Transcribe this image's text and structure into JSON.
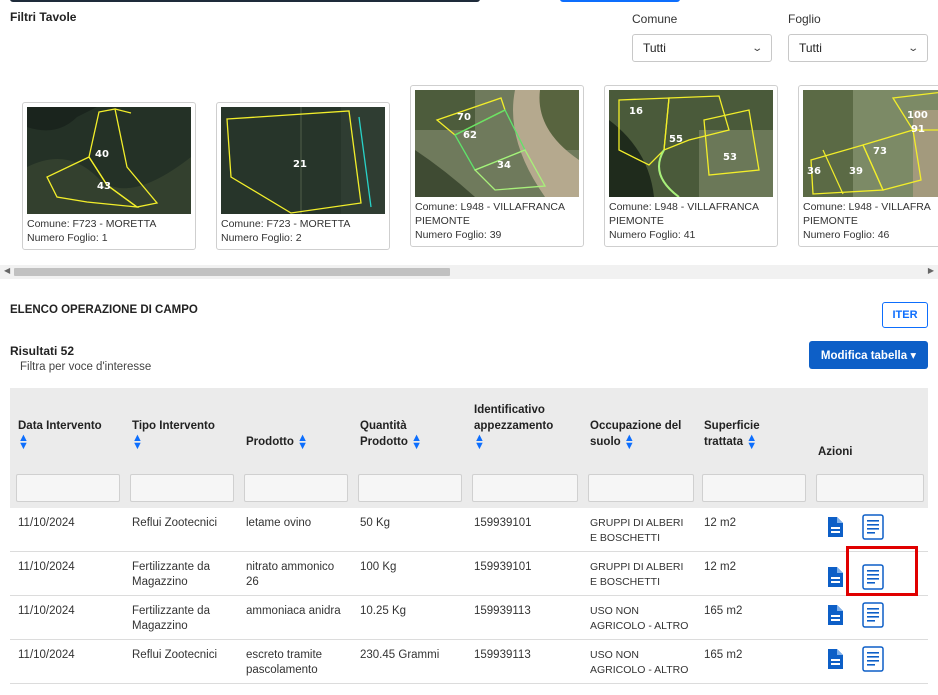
{
  "filters": {
    "title": "Filtri Tavole",
    "comune": {
      "label": "Comune",
      "value": "Tutti"
    },
    "foglio": {
      "label": "Foglio",
      "value": "Tutti"
    }
  },
  "maps": [
    {
      "caption1": "Comune: F723 - MORETTA",
      "caption2": "Numero Foglio: 1",
      "labels": [
        "40",
        "43"
      ]
    },
    {
      "caption1": "Comune: F723 - MORETTA",
      "caption2": "Numero Foglio: 2",
      "labels": [
        "21"
      ]
    },
    {
      "caption1": "Comune: L948 - VILLAFRANCA PIEMONTE",
      "caption2": "Numero Foglio: 39",
      "labels": [
        "70",
        "62",
        "34"
      ]
    },
    {
      "caption1": "Comune: L948 - VILLAFRANCA PIEMONTE",
      "caption2": "Numero Foglio: 41",
      "labels": [
        "16",
        "55",
        "53"
      ]
    },
    {
      "caption1": "Comune: L948 - VILLAFRA",
      "caption2": "PIEMONTE",
      "caption3": "Numero Foglio: 46",
      "labels": [
        "100",
        "91",
        "73",
        "36",
        "39"
      ]
    }
  ],
  "section": {
    "title": "ELENCO OPERAZIONE DI CAMPO",
    "iter_label": "ITER",
    "results": "Risultati 52",
    "filter_hint": "Filtra per voce d'interesse",
    "modifica_label": "Modifica tabella ▾"
  },
  "table": {
    "headers": {
      "data": "Data Intervento",
      "tipo": "Tipo Intervento",
      "prodotto": "Prodotto",
      "quantita_l1": "Quantità",
      "quantita_l2": "Prodotto",
      "ident_l1": "Identificativo",
      "ident_l2": "appezzamento",
      "occ_l1": "Occupazione del",
      "occ_l2": "suolo",
      "sup_l1": "Superficie",
      "sup_l2": "trattata",
      "azioni": "Azioni"
    },
    "rows": [
      {
        "data": "11/10/2024",
        "tipo_l1": "Reflui Zootecnici",
        "tipo_l2": "",
        "prodotto_l1": "letame ovino",
        "prodotto_l2": "",
        "quantita": "50 Kg",
        "ident": "159939101",
        "occ_l1": "GRUPPI DI ALBERI",
        "occ_l2": "E BOSCHETTI",
        "sup": "12 m2"
      },
      {
        "data": "11/10/2024",
        "tipo_l1": "Fertilizzante da",
        "tipo_l2": "Magazzino",
        "prodotto_l1": "nitrato ammonico",
        "prodotto_l2": "26",
        "quantita": "100 Kg",
        "ident": "159939101",
        "occ_l1": "GRUPPI DI ALBERI",
        "occ_l2": "E BOSCHETTI",
        "sup": "12 m2"
      },
      {
        "data": "11/10/2024",
        "tipo_l1": "Fertilizzante da",
        "tipo_l2": "Magazzino",
        "prodotto_l1": "ammoniaca anidra",
        "prodotto_l2": "",
        "quantita": "10.25 Kg",
        "ident": "159939113",
        "occ_l1": "USO NON",
        "occ_l2": "AGRICOLO - ALTRO",
        "sup": "165 m2"
      },
      {
        "data": "11/10/2024",
        "tipo_l1": "Reflui Zootecnici",
        "tipo_l2": "",
        "prodotto_l1": "escreto tramite",
        "prodotto_l2": "pascolamento",
        "quantita": "230.45 Grammi",
        "ident": "159939113",
        "occ_l1": "USO NON",
        "occ_l2": "AGRICOLO - ALTRO",
        "sup": "165 m2"
      }
    ]
  },
  "colors": {
    "accent": "#0d6efd",
    "primary_btn": "#0d5fc7",
    "highlight": "#e00000",
    "parcel_line": "#f2ee2a"
  }
}
